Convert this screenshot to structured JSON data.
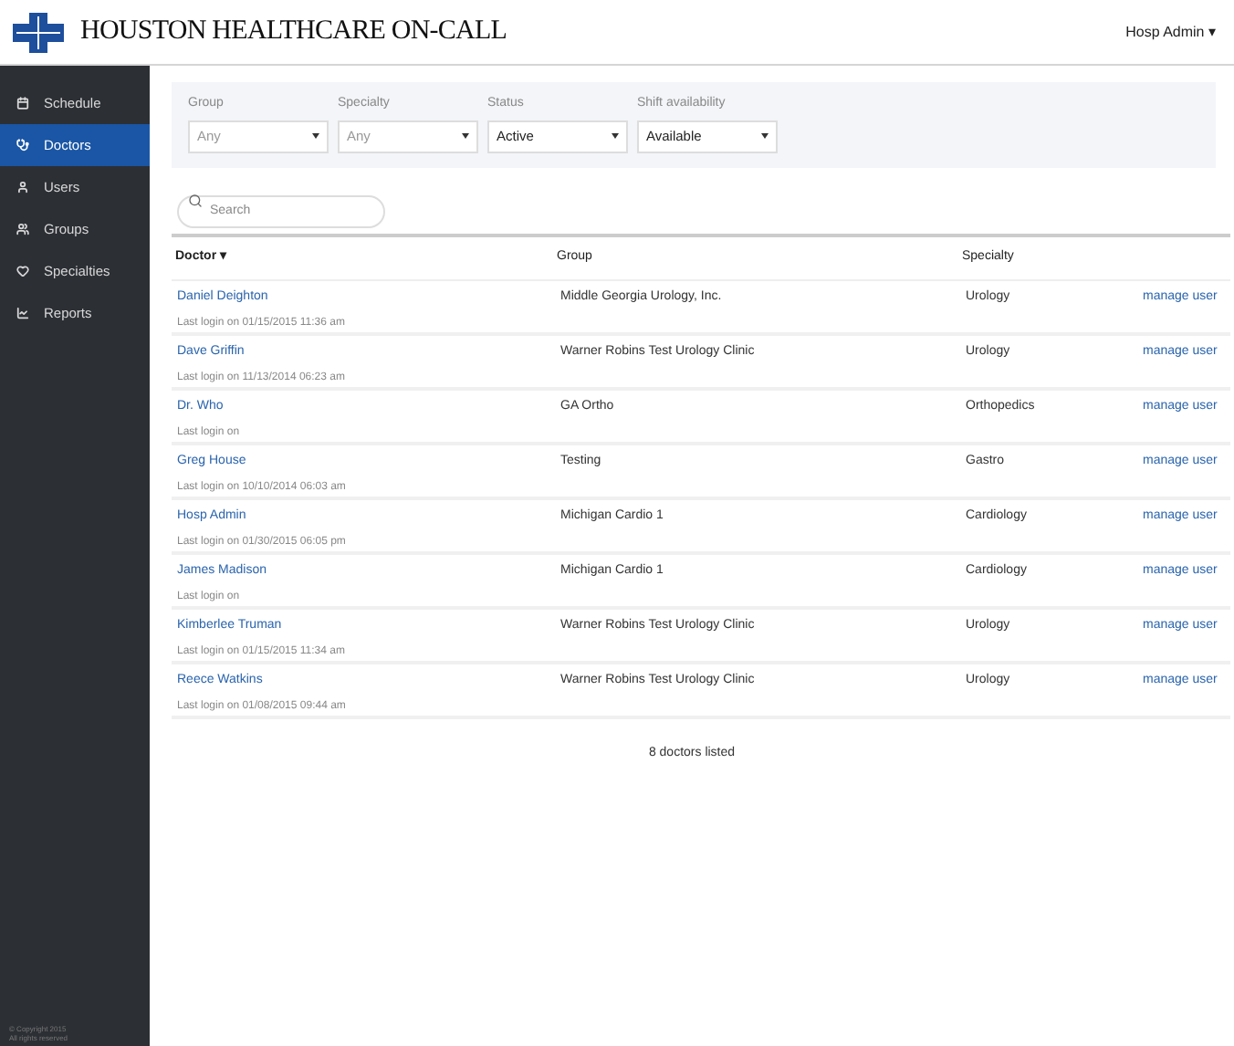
{
  "brand": "HOUSTON HEALTHCARE ON-CALL",
  "user_menu": {
    "label": "Hosp Admin",
    "caret": "▾"
  },
  "sidebar": {
    "items": [
      {
        "label": "Schedule",
        "kind": "calendar",
        "selected": false
      },
      {
        "label": "Doctors",
        "kind": "stethoscope",
        "selected": true
      },
      {
        "label": "Users",
        "kind": "user",
        "selected": false
      },
      {
        "label": "Groups",
        "kind": "users",
        "selected": false
      },
      {
        "label": "Specialties",
        "kind": "heart",
        "selected": false
      },
      {
        "label": "Reports",
        "kind": "chart",
        "selected": false
      }
    ],
    "footer": [
      "© Copyright 2015",
      "All rights reserved"
    ]
  },
  "filters": [
    {
      "label": "Group",
      "value": "Any",
      "placeholder": true
    },
    {
      "label": "Specialty",
      "value": "Any",
      "placeholder": true
    },
    {
      "label": "Status",
      "value": "Active",
      "placeholder": false
    },
    {
      "label": "Shift availability",
      "value": "Available",
      "placeholder": false
    }
  ],
  "search": {
    "placeholder": "Search"
  },
  "table": {
    "columns": [
      {
        "label": "Doctor",
        "sorted": true,
        "caret": "▾"
      },
      {
        "label": "Group",
        "sorted": false
      },
      {
        "label": "Specialty",
        "sorted": false
      }
    ],
    "rows": [
      {
        "name": "Daniel Deighton",
        "last_login": "Last login on 01/15/2015 11:36 am",
        "group": "Middle Georgia Urology, Inc.",
        "specialty": "Urology",
        "action": "manage user"
      },
      {
        "name": "Dave Griffin",
        "last_login": "Last login on 11/13/2014 06:23 am",
        "group": "Warner Robins Test Urology Clinic",
        "specialty": "Urology",
        "action": "manage user"
      },
      {
        "name": "Dr. Who",
        "last_login": "Last login on",
        "group": "GA Ortho",
        "specialty": "Orthopedics",
        "action": "manage user"
      },
      {
        "name": "Greg House",
        "last_login": "Last login on 10/10/2014 06:03 am",
        "group": "Testing",
        "specialty": "Gastro",
        "action": "manage user"
      },
      {
        "name": "Hosp Admin",
        "last_login": "Last login on 01/30/2015 06:05 pm",
        "group": "Michigan Cardio 1",
        "specialty": "Cardiology",
        "action": "manage user"
      },
      {
        "name": "James Madison",
        "last_login": "Last login on",
        "group": "Michigan Cardio 1",
        "specialty": "Cardiology",
        "action": "manage user"
      },
      {
        "name": "Kimberlee Truman",
        "last_login": "Last login on 01/15/2015 11:34 am",
        "group": "Warner Robins Test Urology Clinic",
        "specialty": "Urology",
        "action": "manage user"
      },
      {
        "name": "Reece Watkins",
        "last_login": "Last login on 01/08/2015 09:44 am",
        "group": "Warner Robins Test Urology Clinic",
        "specialty": "Urology",
        "action": "manage user"
      }
    ],
    "footer": "8 doctors listed"
  }
}
